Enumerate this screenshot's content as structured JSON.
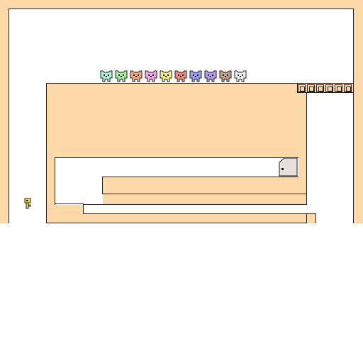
{
  "game": {
    "title": "",
    "colors": {
      "wall": "#fdd8a8",
      "floor": "#ffffff",
      "outline": "#222222",
      "door": "#e6e0dc",
      "key": "#f2e640"
    }
  },
  "cats": [
    {
      "name": "mint",
      "color": "#aef0d8"
    },
    {
      "name": "green",
      "color": "#a8eca0"
    },
    {
      "name": "orange",
      "color": "#f6a87a"
    },
    {
      "name": "pink",
      "color": "#f2a8e8"
    },
    {
      "name": "yellow",
      "color": "#f4ee86"
    },
    {
      "name": "red",
      "color": "#f08a80"
    },
    {
      "name": "blue",
      "color": "#9aa0f4"
    },
    {
      "name": "purple",
      "color": "#b89cf0"
    },
    {
      "name": "brown",
      "color": "#c4a088"
    },
    {
      "name": "white",
      "color": "#f2f2f2"
    }
  ],
  "boxes": 6,
  "key": {
    "icon": "key-icon"
  },
  "door": {
    "icon": "door-icon"
  }
}
